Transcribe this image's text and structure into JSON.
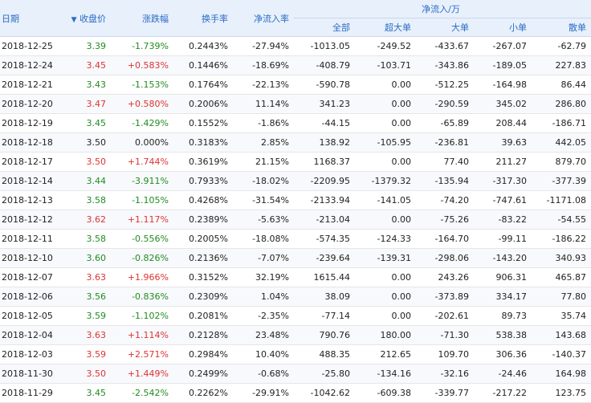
{
  "header": {
    "date": "日期",
    "close": "收盘价",
    "change": "涨跌幅",
    "turnover": "换手率",
    "net_rate": "净流入率",
    "net_flow_group": "净流入/万",
    "sub": [
      "全部",
      "超大单",
      "大单",
      "小单",
      "散单"
    ],
    "sort_icon": "arrow-down-icon"
  },
  "colors": {
    "up": "#e03232",
    "down": "#228b22",
    "header_text": "#2a6bc4",
    "header_bg": "#e8f0fb"
  },
  "rows": [
    {
      "date": "2018-12-25",
      "close": "3.39",
      "change": "-1.739%",
      "turnover": "0.2443%",
      "net_rate": "-27.94%",
      "all": "-1013.05",
      "xl": "-249.52",
      "l": "-433.67",
      "s": "-267.07",
      "r": "-62.79",
      "dir": "down"
    },
    {
      "date": "2018-12-24",
      "close": "3.45",
      "change": "+0.583%",
      "turnover": "0.1446%",
      "net_rate": "-18.69%",
      "all": "-408.79",
      "xl": "-103.71",
      "l": "-343.86",
      "s": "-189.05",
      "r": "227.83",
      "dir": "up"
    },
    {
      "date": "2018-12-21",
      "close": "3.43",
      "change": "-1.153%",
      "turnover": "0.1764%",
      "net_rate": "-22.13%",
      "all": "-590.78",
      "xl": "0.00",
      "l": "-512.25",
      "s": "-164.98",
      "r": "86.44",
      "dir": "down"
    },
    {
      "date": "2018-12-20",
      "close": "3.47",
      "change": "+0.580%",
      "turnover": "0.2006%",
      "net_rate": "11.14%",
      "all": "341.23",
      "xl": "0.00",
      "l": "-290.59",
      "s": "345.02",
      "r": "286.80",
      "dir": "up"
    },
    {
      "date": "2018-12-19",
      "close": "3.45",
      "change": "-1.429%",
      "turnover": "0.1552%",
      "net_rate": "-1.86%",
      "all": "-44.15",
      "xl": "0.00",
      "l": "-65.89",
      "s": "208.44",
      "r": "-186.71",
      "dir": "down"
    },
    {
      "date": "2018-12-18",
      "close": "3.50",
      "change": "0.000%",
      "turnover": "0.3183%",
      "net_rate": "2.85%",
      "all": "138.92",
      "xl": "-105.95",
      "l": "-236.81",
      "s": "39.63",
      "r": "442.05",
      "dir": "flat"
    },
    {
      "date": "2018-12-17",
      "close": "3.50",
      "change": "+1.744%",
      "turnover": "0.3619%",
      "net_rate": "21.15%",
      "all": "1168.37",
      "xl": "0.00",
      "l": "77.40",
      "s": "211.27",
      "r": "879.70",
      "dir": "up"
    },
    {
      "date": "2018-12-14",
      "close": "3.44",
      "change": "-3.911%",
      "turnover": "0.7933%",
      "net_rate": "-18.02%",
      "all": "-2209.95",
      "xl": "-1379.32",
      "l": "-135.94",
      "s": "-317.30",
      "r": "-377.39",
      "dir": "down"
    },
    {
      "date": "2018-12-13",
      "close": "3.58",
      "change": "-1.105%",
      "turnover": "0.4268%",
      "net_rate": "-31.54%",
      "all": "-2133.94",
      "xl": "-141.05",
      "l": "-74.20",
      "s": "-747.61",
      "r": "-1171.08",
      "dir": "down"
    },
    {
      "date": "2018-12-12",
      "close": "3.62",
      "change": "+1.117%",
      "turnover": "0.2389%",
      "net_rate": "-5.63%",
      "all": "-213.04",
      "xl": "0.00",
      "l": "-75.26",
      "s": "-83.22",
      "r": "-54.55",
      "dir": "up"
    },
    {
      "date": "2018-12-11",
      "close": "3.58",
      "change": "-0.556%",
      "turnover": "0.2005%",
      "net_rate": "-18.08%",
      "all": "-574.35",
      "xl": "-124.33",
      "l": "-164.70",
      "s": "-99.11",
      "r": "-186.22",
      "dir": "down"
    },
    {
      "date": "2018-12-10",
      "close": "3.60",
      "change": "-0.826%",
      "turnover": "0.2136%",
      "net_rate": "-7.07%",
      "all": "-239.64",
      "xl": "-139.31",
      "l": "-298.06",
      "s": "-143.20",
      "r": "340.93",
      "dir": "down"
    },
    {
      "date": "2018-12-07",
      "close": "3.63",
      "change": "+1.966%",
      "turnover": "0.3152%",
      "net_rate": "32.19%",
      "all": "1615.44",
      "xl": "0.00",
      "l": "243.26",
      "s": "906.31",
      "r": "465.87",
      "dir": "up"
    },
    {
      "date": "2018-12-06",
      "close": "3.56",
      "change": "-0.836%",
      "turnover": "0.2309%",
      "net_rate": "1.04%",
      "all": "38.09",
      "xl": "0.00",
      "l": "-373.89",
      "s": "334.17",
      "r": "77.80",
      "dir": "down"
    },
    {
      "date": "2018-12-05",
      "close": "3.59",
      "change": "-1.102%",
      "turnover": "0.2081%",
      "net_rate": "-2.35%",
      "all": "-77.14",
      "xl": "0.00",
      "l": "-202.61",
      "s": "89.73",
      "r": "35.74",
      "dir": "down"
    },
    {
      "date": "2018-12-04",
      "close": "3.63",
      "change": "+1.114%",
      "turnover": "0.2128%",
      "net_rate": "23.48%",
      "all": "790.76",
      "xl": "180.00",
      "l": "-71.30",
      "s": "538.38",
      "r": "143.68",
      "dir": "up"
    },
    {
      "date": "2018-12-03",
      "close": "3.59",
      "change": "+2.571%",
      "turnover": "0.2984%",
      "net_rate": "10.40%",
      "all": "488.35",
      "xl": "212.65",
      "l": "109.70",
      "s": "306.36",
      "r": "-140.37",
      "dir": "up"
    },
    {
      "date": "2018-11-30",
      "close": "3.50",
      "change": "+1.449%",
      "turnover": "0.2499%",
      "net_rate": "-0.68%",
      "all": "-25.80",
      "xl": "-134.16",
      "l": "-32.16",
      "s": "-24.46",
      "r": "164.98",
      "dir": "up"
    },
    {
      "date": "2018-11-29",
      "close": "3.45",
      "change": "-2.542%",
      "turnover": "0.2262%",
      "net_rate": "-29.91%",
      "all": "-1042.62",
      "xl": "-609.38",
      "l": "-339.77",
      "s": "-217.22",
      "r": "123.75",
      "dir": "down"
    }
  ]
}
